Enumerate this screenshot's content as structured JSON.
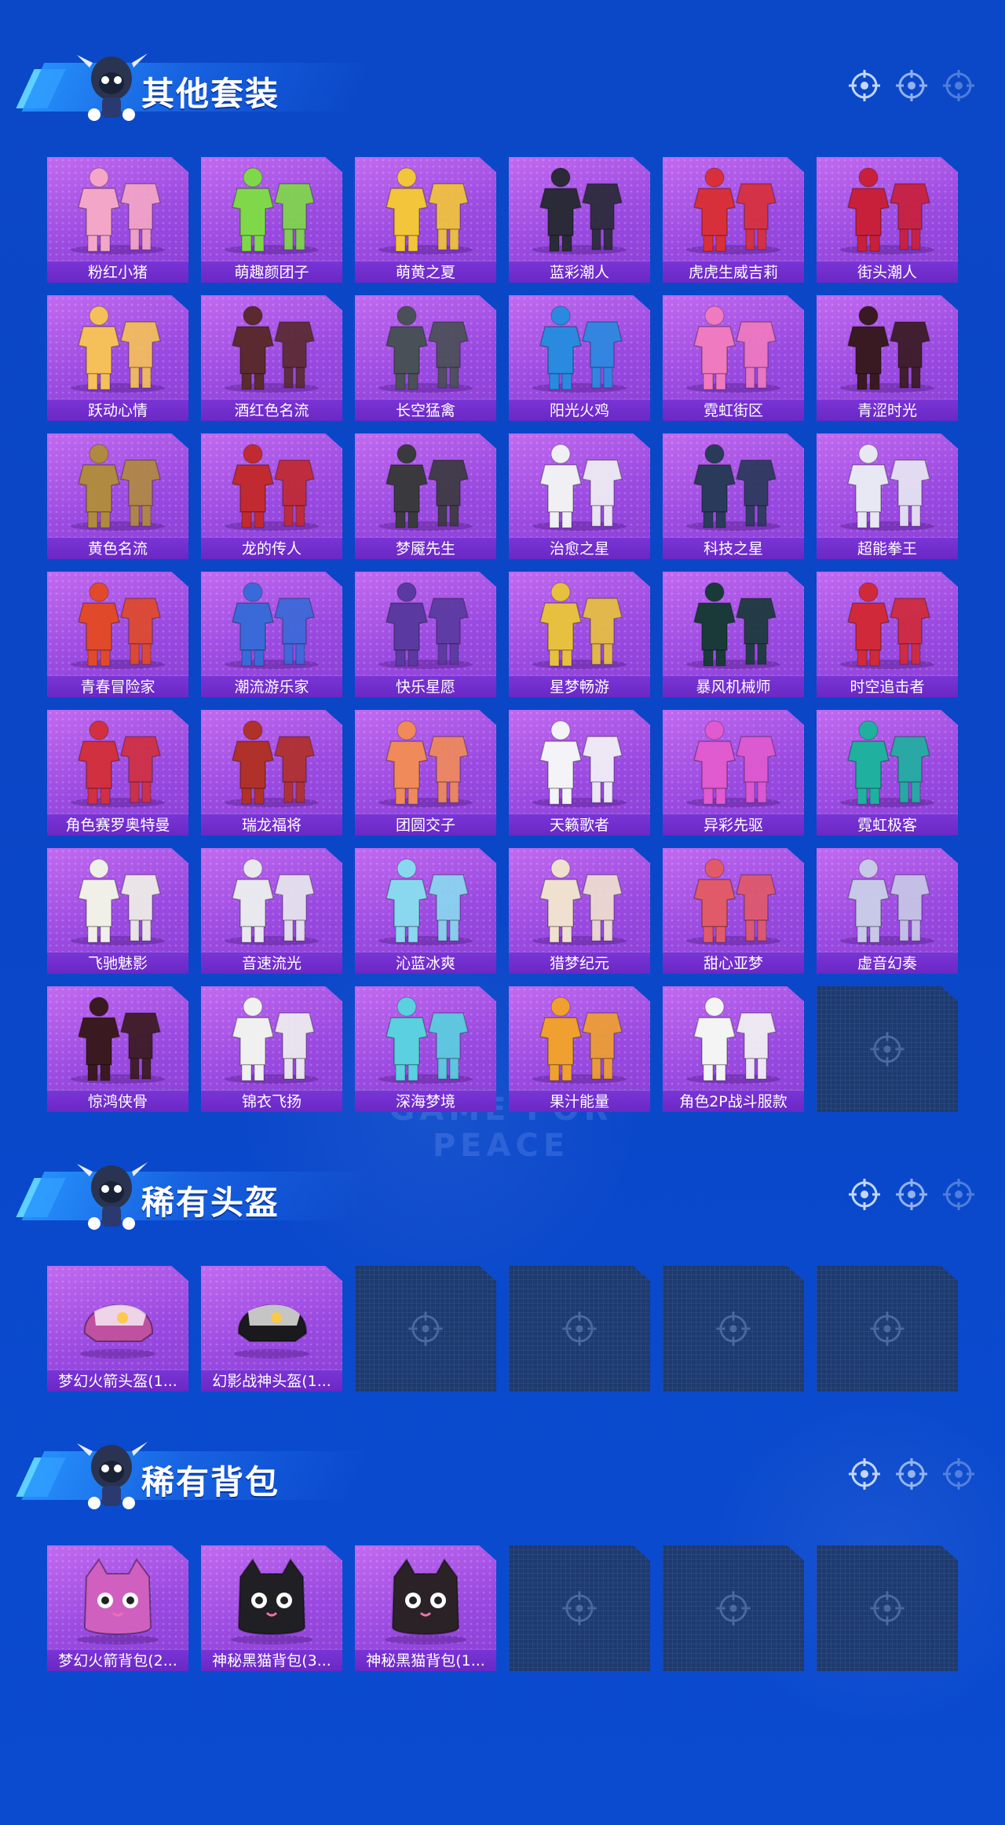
{
  "colors": {
    "background": "#0a48c8",
    "card": "#a855e6",
    "label_bar": "#6a28c4",
    "empty_card": "#1e3a6e"
  },
  "watermark": "GAME FOR PEACE",
  "sections": [
    {
      "title": "其他套装",
      "items": [
        {
          "name": "粉红小猪",
          "art": "outfit-icon",
          "color": "#f4a6c8"
        },
        {
          "name": "萌趣颜团子",
          "art": "outfit-icon",
          "color": "#7fd84a"
        },
        {
          "name": "萌黄之夏",
          "art": "outfit-icon",
          "color": "#f2c53a"
        },
        {
          "name": "蓝彩潮人",
          "art": "outfit-icon",
          "color": "#2a2a38"
        },
        {
          "name": "虎虎生威吉莉",
          "art": "outfit-icon",
          "color": "#d8303a"
        },
        {
          "name": "街头潮人",
          "art": "outfit-icon",
          "color": "#c8203a"
        },
        {
          "name": "跃动心情",
          "art": "outfit-icon",
          "color": "#f5c05a"
        },
        {
          "name": "酒红色名流",
          "art": "outfit-icon",
          "color": "#5a2a30"
        },
        {
          "name": "长空猛禽",
          "art": "outfit-icon",
          "color": "#4a5058"
        },
        {
          "name": "阳光火鸡",
          "art": "outfit-icon",
          "color": "#2a8ae0"
        },
        {
          "name": "霓虹街区",
          "art": "outfit-icon",
          "color": "#f07ac0"
        },
        {
          "name": "青涩时光",
          "art": "outfit-icon",
          "color": "#3a1a22"
        },
        {
          "name": "黄色名流",
          "art": "outfit-icon",
          "color": "#b08a40"
        },
        {
          "name": "龙的传人",
          "art": "outfit-icon",
          "color": "#c02a30"
        },
        {
          "name": "梦魇先生",
          "art": "outfit-icon",
          "color": "#3a3a3e"
        },
        {
          "name": "治愈之星",
          "art": "outfit-icon",
          "color": "#f0f0f4"
        },
        {
          "name": "科技之星",
          "art": "outfit-icon",
          "color": "#2a3a5a"
        },
        {
          "name": "超能拳王",
          "art": "outfit-icon",
          "color": "#e8e8f4"
        },
        {
          "name": "青春冒险家",
          "art": "outfit-icon",
          "color": "#e04a2a"
        },
        {
          "name": "潮流游乐家",
          "art": "outfit-icon",
          "color": "#3a6ad8"
        },
        {
          "name": "快乐星愿",
          "art": "outfit-icon",
          "color": "#5a3aa0"
        },
        {
          "name": "星梦畅游",
          "art": "outfit-icon",
          "color": "#e8c040"
        },
        {
          "name": "暴风机械师",
          "art": "outfit-icon",
          "color": "#1a3a3a"
        },
        {
          "name": "时空追击者",
          "art": "outfit-icon",
          "color": "#d02a3a"
        },
        {
          "name": "角色赛罗奥特曼",
          "art": "outfit-icon",
          "color": "#d03040"
        },
        {
          "name": "瑞龙福将",
          "art": "outfit-icon",
          "color": "#b0302a"
        },
        {
          "name": "团圆交子",
          "art": "outfit-icon",
          "color": "#f08a5a"
        },
        {
          "name": "天籁歌者",
          "art": "outfit-icon",
          "color": "#f4f4f8"
        },
        {
          "name": "异彩先驱",
          "art": "outfit-icon",
          "color": "#e05ad0"
        },
        {
          "name": "霓虹极客",
          "art": "outfit-icon",
          "color": "#20b0a0"
        },
        {
          "name": "飞驰魅影",
          "art": "outfit-icon",
          "color": "#f0f0e8"
        },
        {
          "name": "音速流光",
          "art": "outfit-icon",
          "color": "#e8e8ee"
        },
        {
          "name": "沁蓝冰爽",
          "art": "outfit-icon",
          "color": "#8ad8f0"
        },
        {
          "name": "猎梦纪元",
          "art": "outfit-icon",
          "color": "#f0e0d0"
        },
        {
          "name": "甜心亚梦",
          "art": "outfit-icon",
          "color": "#e05a6a"
        },
        {
          "name": "虚音幻奏",
          "art": "outfit-icon",
          "color": "#c8c8e8"
        },
        {
          "name": "惊鸿侠骨",
          "art": "outfit-icon",
          "color": "#3a1a20"
        },
        {
          "name": "锦衣飞扬",
          "art": "outfit-icon",
          "color": "#f0f0f0"
        },
        {
          "name": "深海梦境",
          "art": "outfit-icon",
          "color": "#5ad0e0"
        },
        {
          "name": "果汁能量",
          "art": "outfit-icon",
          "color": "#f0a030"
        },
        {
          "name": "角色2P战斗服款",
          "art": "outfit-icon",
          "color": "#f4f4f4"
        },
        {
          "empty": true
        }
      ]
    },
    {
      "title": "稀有头盔",
      "items": [
        {
          "name": "梦幻火箭头盔(1...",
          "art": "helmet-icon",
          "color": "#c050a0"
        },
        {
          "name": "幻影战神头盔(1...",
          "art": "helmet-icon",
          "color": "#1a1a1e"
        },
        {
          "empty": true
        },
        {
          "empty": true
        },
        {
          "empty": true
        },
        {
          "empty": true
        }
      ]
    },
    {
      "title": "稀有背包",
      "items": [
        {
          "name": "梦幻火箭背包(2...",
          "art": "backpack-icon",
          "color": "#d060c0"
        },
        {
          "name": "神秘黑猫背包(3...",
          "art": "backpack-icon",
          "color": "#202024"
        },
        {
          "name": "神秘黑猫背包(1...",
          "art": "backpack-icon",
          "color": "#2a2226"
        },
        {
          "empty": true
        },
        {
          "empty": true
        },
        {
          "empty": true
        }
      ]
    }
  ]
}
